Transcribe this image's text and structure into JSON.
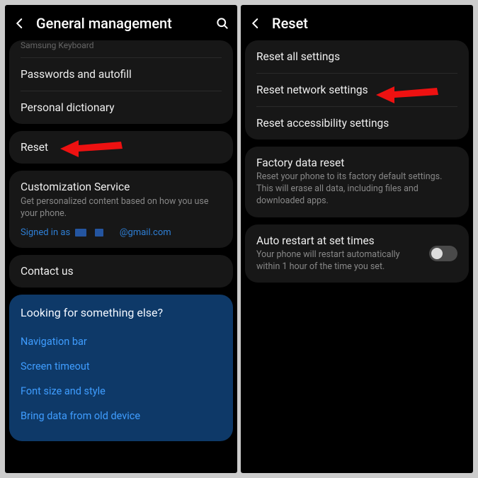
{
  "left": {
    "header": {
      "title": "General management"
    },
    "partialItem": "Samsung Keyboard",
    "group1": [
      "Passwords and autofill",
      "Personal dictionary"
    ],
    "resetLabel": "Reset",
    "customization": {
      "title": "Customization Service",
      "subtitle": "Get personalized content based on how you use your phone.",
      "signedInLabel": "Signed in as",
      "email": "@gmail.com"
    },
    "contactLabel": "Contact us",
    "suggestions": {
      "title": "Looking for something else?",
      "links": [
        "Navigation bar",
        "Screen timeout",
        "Font size and style",
        "Bring data from old device"
      ]
    }
  },
  "right": {
    "header": {
      "title": "Reset"
    },
    "group1": [
      "Reset all settings",
      "Reset network settings",
      "Reset accessibility settings"
    ],
    "factory": {
      "title": "Factory data reset",
      "desc": "Reset your phone to its factory default settings. This will erase all data, including files and downloaded apps."
    },
    "autoRestart": {
      "title": "Auto restart at set times",
      "desc": "Your phone will restart automatically within 1 hour of the time you set."
    }
  }
}
